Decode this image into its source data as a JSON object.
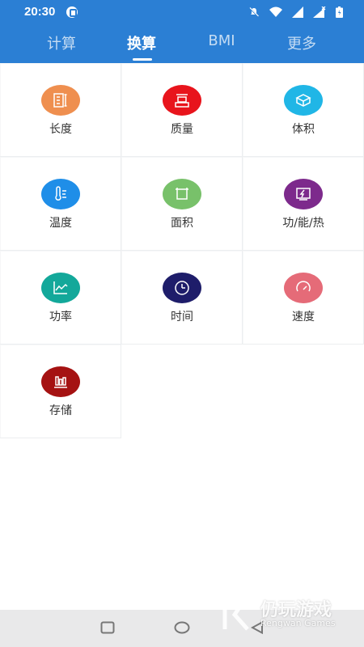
{
  "status_bar": {
    "time": "20:30"
  },
  "tabs": [
    {
      "label": "计算",
      "active": false
    },
    {
      "label": "换算",
      "active": true
    },
    {
      "label": "BMI",
      "active": false
    },
    {
      "label": "更多",
      "active": false
    }
  ],
  "categories": [
    {
      "label": "长度",
      "icon": "ruler-icon",
      "color": "#ef8f4f"
    },
    {
      "label": "质量",
      "icon": "scale-icon",
      "color": "#e8141c"
    },
    {
      "label": "体积",
      "icon": "cube-icon",
      "color": "#20b6e6"
    },
    {
      "label": "温度",
      "icon": "thermometer-icon",
      "color": "#1f8ee8"
    },
    {
      "label": "面积",
      "icon": "area-icon",
      "color": "#78c16a"
    },
    {
      "label": "功/能/热",
      "icon": "energy-icon",
      "color": "#7d2a8c"
    },
    {
      "label": "功率",
      "icon": "power-chart-icon",
      "color": "#13a89a"
    },
    {
      "label": "时间",
      "icon": "clock-icon",
      "color": "#1e1d6a"
    },
    {
      "label": "速度",
      "icon": "speedometer-icon",
      "color": "#e56b78"
    },
    {
      "label": "存储",
      "icon": "storage-icon",
      "color": "#a51212"
    }
  ],
  "watermark": {
    "text": "仍玩游戏",
    "subtext": "Rengwan Games"
  }
}
